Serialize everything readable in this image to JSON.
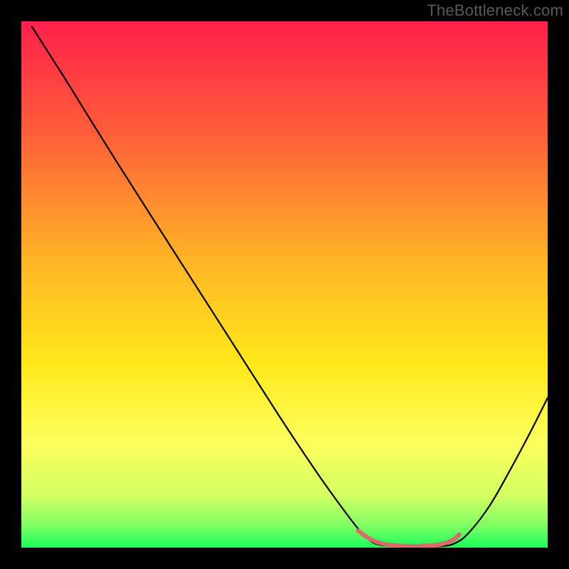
{
  "watermark": "TheBottleneck.com",
  "chart_data": {
    "type": "line",
    "title": "",
    "xlabel": "",
    "ylabel": "",
    "xlim": [
      0,
      100
    ],
    "ylim": [
      0,
      100
    ],
    "grid": false,
    "legend": false,
    "gradient_stops": [
      {
        "offset": 0.0,
        "color": "#ff204b"
      },
      {
        "offset": 0.2,
        "color": "#ff5a3a"
      },
      {
        "offset": 0.45,
        "color": "#ffb326"
      },
      {
        "offset": 0.65,
        "color": "#ffe81a"
      },
      {
        "offset": 0.8,
        "color": "#fdff5d"
      },
      {
        "offset": 0.9,
        "color": "#d4ff61"
      },
      {
        "offset": 0.96,
        "color": "#7cff63"
      },
      {
        "offset": 1.0,
        "color": "#17ff5b"
      }
    ],
    "series": [
      {
        "name": "bottleneck-curve",
        "stroke": "#000000",
        "stroke_width": 2.2,
        "points": [
          {
            "x": 2.0,
            "y": 99.0
          },
          {
            "x": 5.5,
            "y": 93.5
          },
          {
            "x": 9.0,
            "y": 88.0
          },
          {
            "x": 13.0,
            "y": 81.5
          },
          {
            "x": 18.0,
            "y": 73.5
          },
          {
            "x": 25.0,
            "y": 62.5
          },
          {
            "x": 33.0,
            "y": 50.0
          },
          {
            "x": 41.0,
            "y": 37.5
          },
          {
            "x": 49.0,
            "y": 25.0
          },
          {
            "x": 56.0,
            "y": 14.5
          },
          {
            "x": 61.0,
            "y": 7.5
          },
          {
            "x": 64.5,
            "y": 3.0
          },
          {
            "x": 67.0,
            "y": 0.9
          },
          {
            "x": 70.0,
            "y": 0.3
          },
          {
            "x": 75.0,
            "y": 0.2
          },
          {
            "x": 80.0,
            "y": 0.3
          },
          {
            "x": 82.5,
            "y": 0.9
          },
          {
            "x": 85.0,
            "y": 2.8
          },
          {
            "x": 89.0,
            "y": 8.0
          },
          {
            "x": 93.0,
            "y": 15.0
          },
          {
            "x": 97.0,
            "y": 22.5
          },
          {
            "x": 100.0,
            "y": 28.5
          }
        ]
      },
      {
        "name": "optimal-zone-marker",
        "stroke": "#d96a6a",
        "stroke_width": 6,
        "dots_radius": 3.2,
        "points": [
          {
            "x": 64.0,
            "y": 3.2
          },
          {
            "x": 65.2,
            "y": 2.3
          },
          {
            "x": 66.4,
            "y": 1.6
          },
          {
            "x": 67.8,
            "y": 1.0
          },
          {
            "x": 69.5,
            "y": 0.6
          },
          {
            "x": 71.5,
            "y": 0.4
          },
          {
            "x": 73.5,
            "y": 0.3
          },
          {
            "x": 75.5,
            "y": 0.3
          },
          {
            "x": 77.5,
            "y": 0.4
          },
          {
            "x": 79.5,
            "y": 0.6
          },
          {
            "x": 81.0,
            "y": 1.0
          },
          {
            "x": 82.2,
            "y": 1.6
          },
          {
            "x": 83.2,
            "y": 2.5
          }
        ]
      }
    ]
  }
}
